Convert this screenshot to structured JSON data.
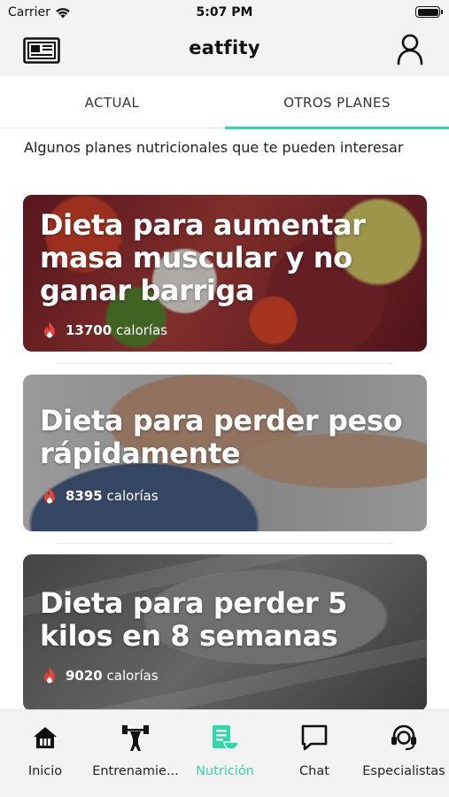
{
  "status_bar": {
    "carrier": "Carrier",
    "time": "5:07 PM"
  },
  "header": {
    "title": "eatfity",
    "left_icon": "newspaper-icon",
    "right_icon": "user-icon"
  },
  "tabs": [
    {
      "label": "ACTUAL",
      "active": false
    },
    {
      "label": "OTROS PLANES",
      "active": true
    }
  ],
  "intro_text": "Algunos planes nutricionales que te pueden interesar",
  "plans": [
    {
      "title": "Dieta para aumentar masa muscular y no ganar barriga",
      "calories": "13700",
      "calories_unit": "calorías"
    },
    {
      "title": "Dieta para perder peso rápidamente",
      "calories": "8395",
      "calories_unit": "calorías"
    },
    {
      "title": "Dieta para perder 5 kilos en 8 semanas",
      "calories": "9020",
      "calories_unit": "calorías"
    }
  ],
  "bottom_nav": [
    {
      "label": "Inicio",
      "icon": "home-icon",
      "active": false
    },
    {
      "label": "Entrenamie...",
      "icon": "dumbbell-icon",
      "active": false
    },
    {
      "label": "Nutrición",
      "icon": "nutrition-icon",
      "active": true
    },
    {
      "label": "Chat",
      "icon": "chat-icon",
      "active": false
    },
    {
      "label": "Especialistas",
      "icon": "headset-icon",
      "active": false
    }
  ],
  "colors": {
    "accent": "#2ed8a7",
    "fire": "#e8413a",
    "bar_background": "#f3f3f3"
  }
}
